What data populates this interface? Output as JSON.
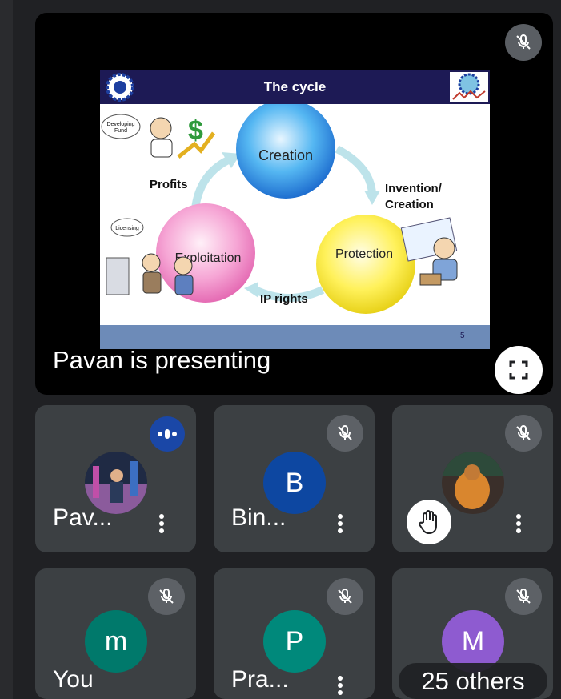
{
  "presentation": {
    "presenter_label": "Pavan is presenting",
    "slide": {
      "title": "The cycle",
      "nodes": {
        "creation": "Creation",
        "protection": "Protection",
        "exploitation": "Exploitation"
      },
      "labels": {
        "profits": "Profits",
        "invention_line1": "Invention/",
        "invention_line2": "Creation",
        "ip_rights": "IP rights",
        "bubble_fund_line1": "Developing",
        "bubble_fund_line2": "Fund",
        "bubble_licensing": "Licensing"
      },
      "page_number": "5"
    }
  },
  "participants": [
    {
      "name": "Pav...",
      "avatar_letter": "",
      "status": "speaking"
    },
    {
      "name": "Bin...",
      "avatar_letter": "B",
      "status": "muted"
    },
    {
      "name": "",
      "avatar_letter": "",
      "status": "muted",
      "hand_raised": true
    },
    {
      "name": "You",
      "avatar_letter": "m",
      "status": "muted"
    },
    {
      "name": "Pra...",
      "avatar_letter": "P",
      "status": "muted"
    },
    {
      "name": "",
      "avatar_letter": "M",
      "status": "muted",
      "overflow_label": "25 others"
    }
  ],
  "colors": {
    "background": "#202124",
    "tile": "#3c4043",
    "avatar_b": "#0d47a1",
    "avatar_m_lower": "#00796b",
    "avatar_p": "#00897b",
    "avatar_m_upper": "#8e5bd0",
    "speaking": "#1a47a7"
  }
}
